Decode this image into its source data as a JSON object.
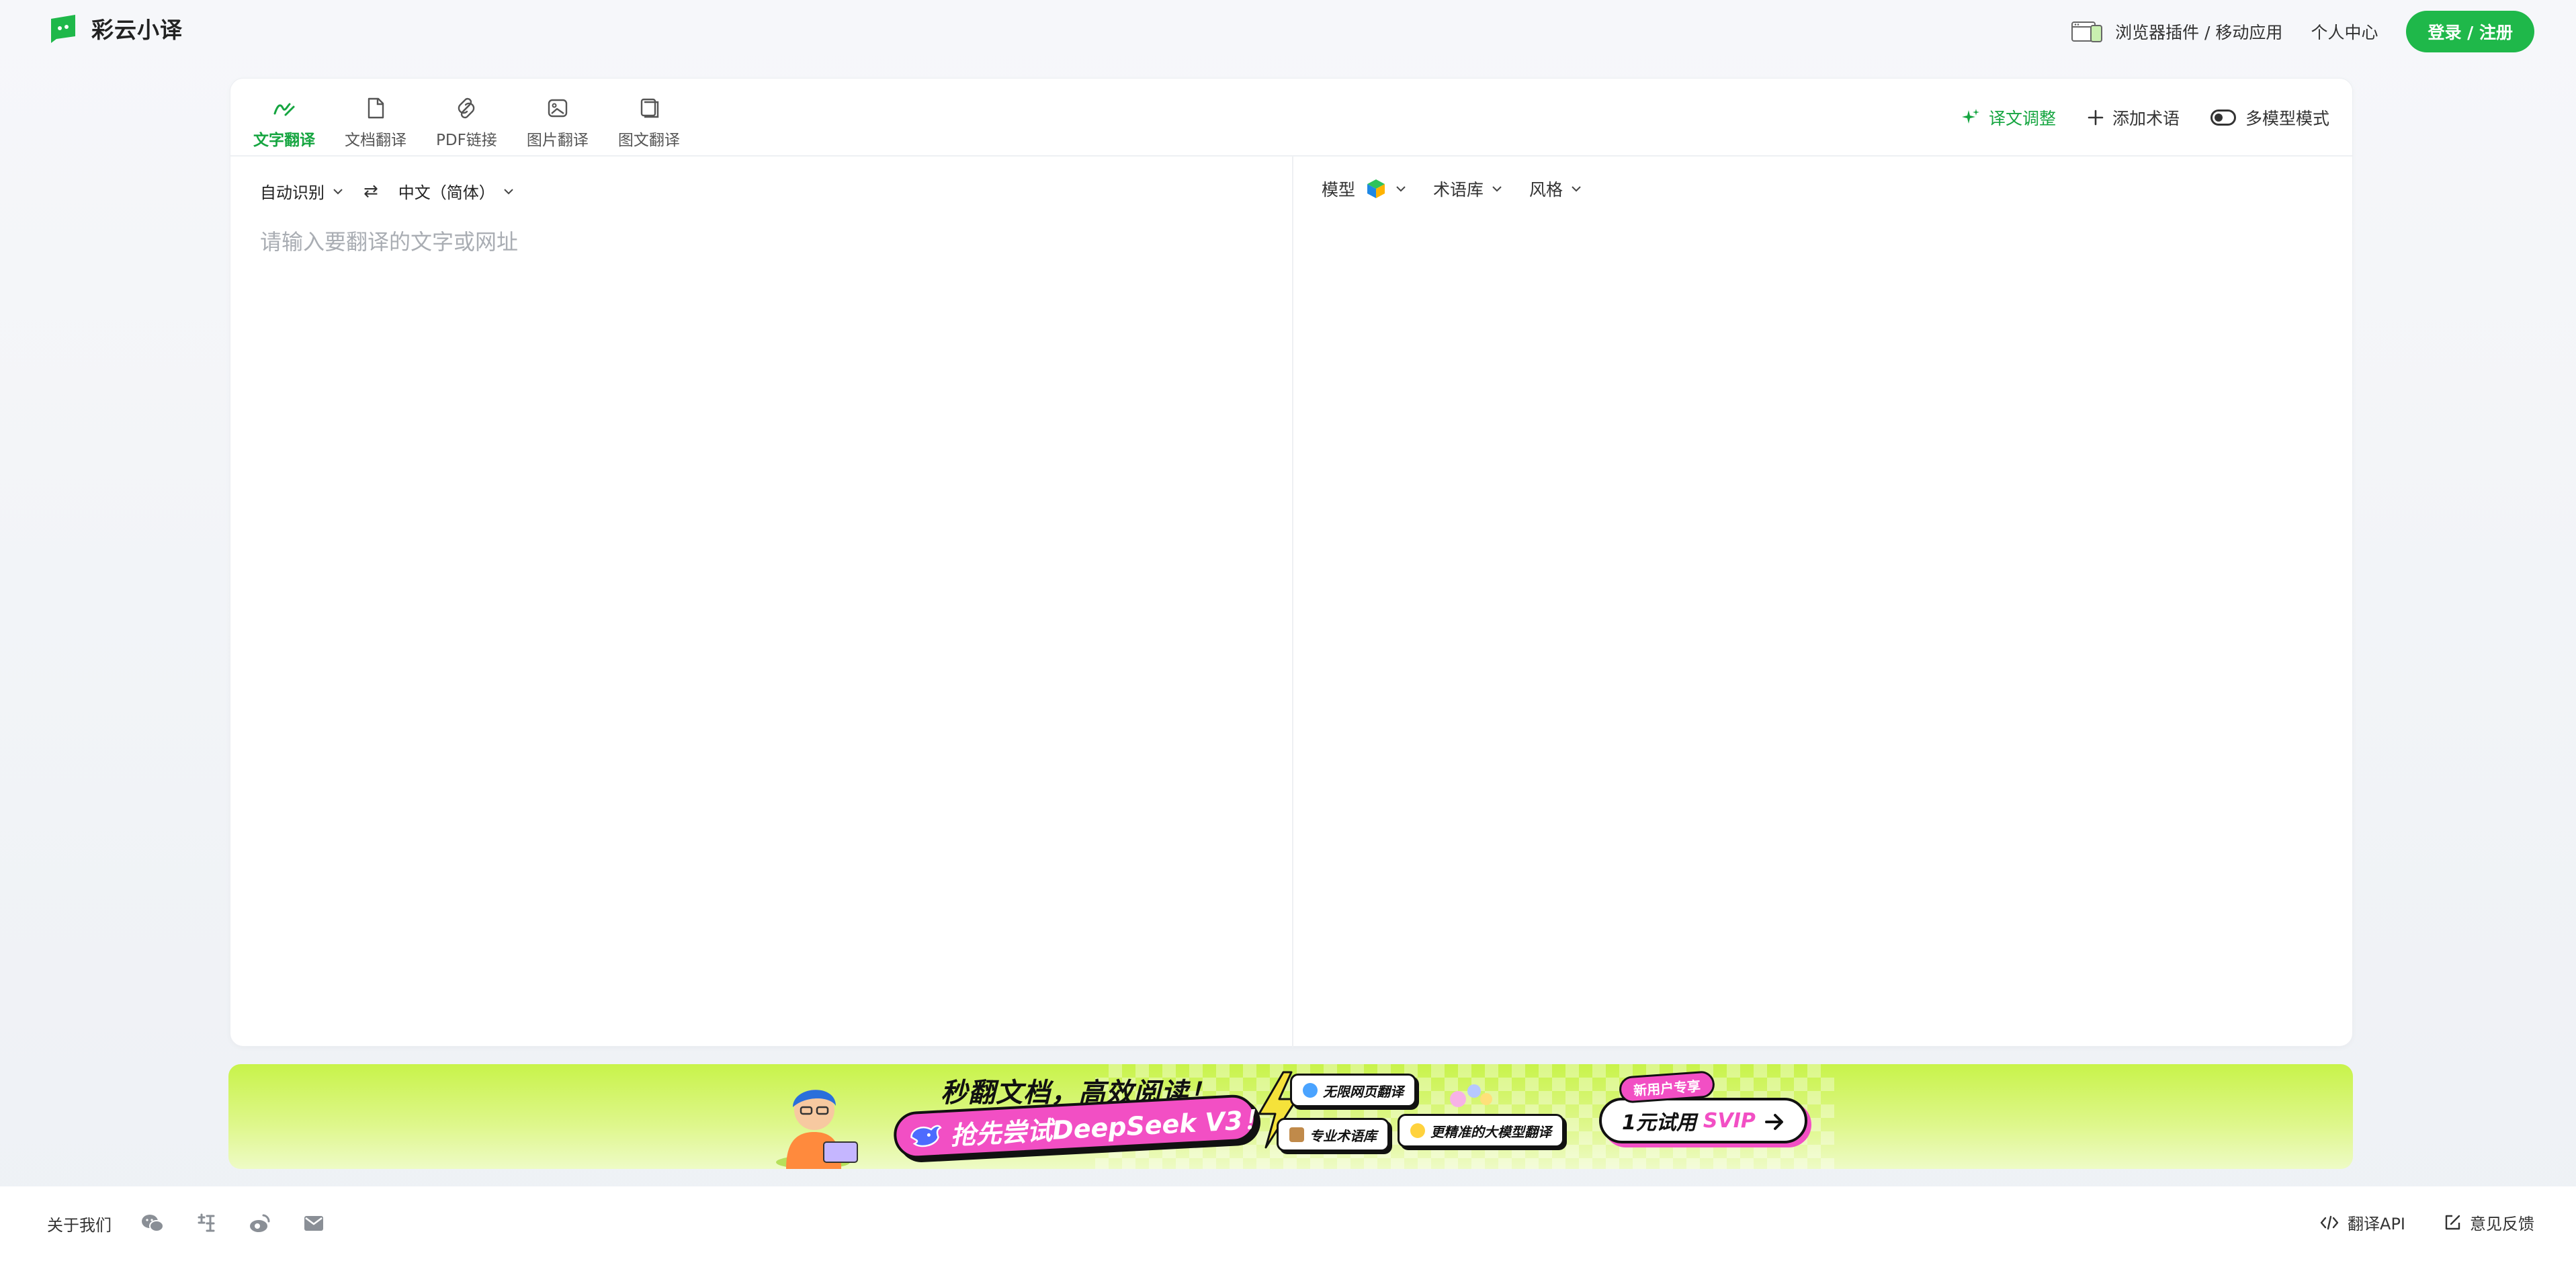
{
  "header": {
    "logo_text": "彩云小译",
    "plugin_link": "浏览器插件 / 移动应用",
    "personal_center": "个人中心",
    "login_label": "登录 / 注册"
  },
  "tabs": [
    {
      "label": "文字翻译",
      "icon": "text-translate-icon",
      "active": true
    },
    {
      "label": "文档翻译",
      "icon": "document-icon",
      "active": false
    },
    {
      "label": "PDF链接",
      "icon": "link-icon",
      "active": false
    },
    {
      "label": "图片翻译",
      "icon": "image-icon",
      "active": false
    },
    {
      "label": "图文翻译",
      "icon": "book-icon",
      "active": false
    }
  ],
  "actions": {
    "adjust": "译文调整",
    "add_term": "添加术语",
    "multi_model": "多模型模式"
  },
  "source": {
    "from_lang": "自动识别",
    "to_lang": "中文（简体）",
    "placeholder": "请输入要翻译的文字或网址",
    "value": ""
  },
  "target": {
    "model_label": "模型",
    "glossary_label": "术语库",
    "style_label": "风格"
  },
  "banner": {
    "title": "秒翻文档，高效阅读！",
    "pill": "抢先尝试DeepSeek V3！",
    "tag1": "无限网页翻译",
    "tag2": "专业术语库",
    "tag3": "更精准的大模型翻译",
    "badge": "新用户专享",
    "cta_prefix": "1元试用",
    "cta_svip": "SVIP"
  },
  "footer": {
    "about": "关于我们",
    "api": "翻译API",
    "feedback": "意见反馈",
    "icons": [
      "wechat-icon",
      "xiaohongshu-icon",
      "weibo-icon",
      "mail-icon"
    ]
  },
  "colors": {
    "brand_green": "#1fb84a",
    "active_green": "#15a540",
    "banner_pink": "#f24fc4",
    "banner_lime": "#c8f34a"
  }
}
